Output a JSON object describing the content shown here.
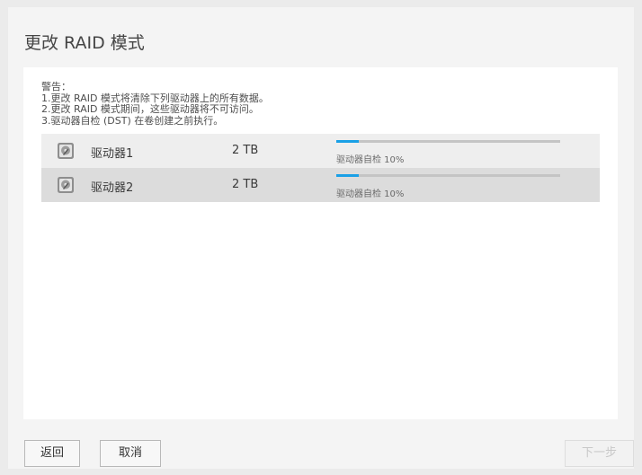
{
  "dialog": {
    "title": "更改 RAID 模式",
    "warning": {
      "heading": "警告：",
      "lines": [
        "1.更改 RAID 模式将清除下列驱动器上的所有数据。",
        "2.更改 RAID 模式期间，这些驱动器将不可访问。",
        "3.驱动器自检 (DST) 在卷创建之前执行。"
      ]
    },
    "drives": [
      {
        "name": "驱动器1",
        "size": "2 TB",
        "status": "驱动器自检 10%",
        "progress_percent": 10
      },
      {
        "name": "驱动器2",
        "size": "2 TB",
        "status": "驱动器自检 10%",
        "progress_percent": 10
      }
    ],
    "buttons": {
      "back": "返回",
      "cancel": "取消",
      "next": "下一步"
    }
  },
  "colors": {
    "progress_fill": "#1aa0e6",
    "progress_track": "#c4c4c4",
    "row_alt": "#dcdcdc"
  },
  "icons": {
    "drive": "hard-drive-icon"
  }
}
